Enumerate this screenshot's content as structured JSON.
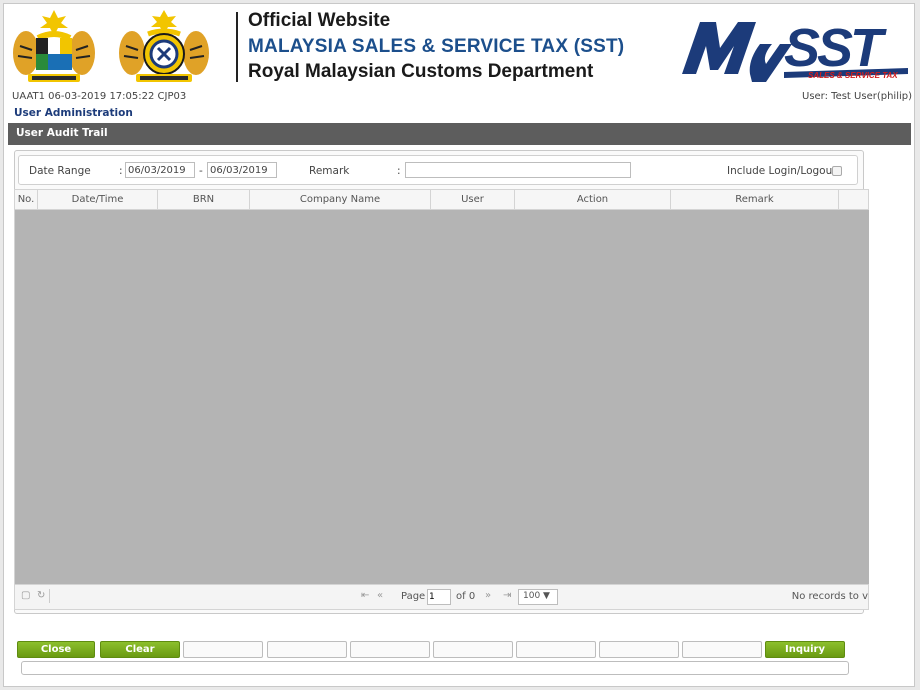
{
  "header": {
    "line1": "Official Website",
    "line2": "MALAYSIA SALES & SERVICE TAX (SST)",
    "line3": "Royal Malaysian Customs Department",
    "logo_text": "MySST",
    "logo_tagline": "SALES & SERVICE TAX",
    "colors": {
      "brand_blue": "#1c4f8c",
      "logo_red": "#d21c1c"
    }
  },
  "info": {
    "left": "UAAT1  06-03-2019  17:05:22  CJP03",
    "right": "User: Test User(philip)"
  },
  "section_title": "User Administration",
  "panel_title": "User Audit Trail",
  "filters": {
    "date_label": "Date Range",
    "colon": ":",
    "date_from": "06/03/2019",
    "dash": "-",
    "date_to": "06/03/2019",
    "remark_label": "Remark",
    "remark_value": "",
    "login_label": "Include Login/Logout:",
    "login_checked": false
  },
  "grid": {
    "columns": [
      "No.",
      "Date/Time",
      "BRN",
      "Company Name",
      "User",
      "Action",
      "Remark"
    ],
    "rows": [],
    "pager": {
      "page_label": "Page",
      "page_value": "1",
      "of_label": "of 0",
      "rows_per_page": "100 ▼",
      "no_records": "No records to v"
    }
  },
  "buttons": {
    "close": "Close",
    "clear": "Clear",
    "inquiry": "Inquiry",
    "colors": {
      "green": "#7aad1f"
    }
  }
}
